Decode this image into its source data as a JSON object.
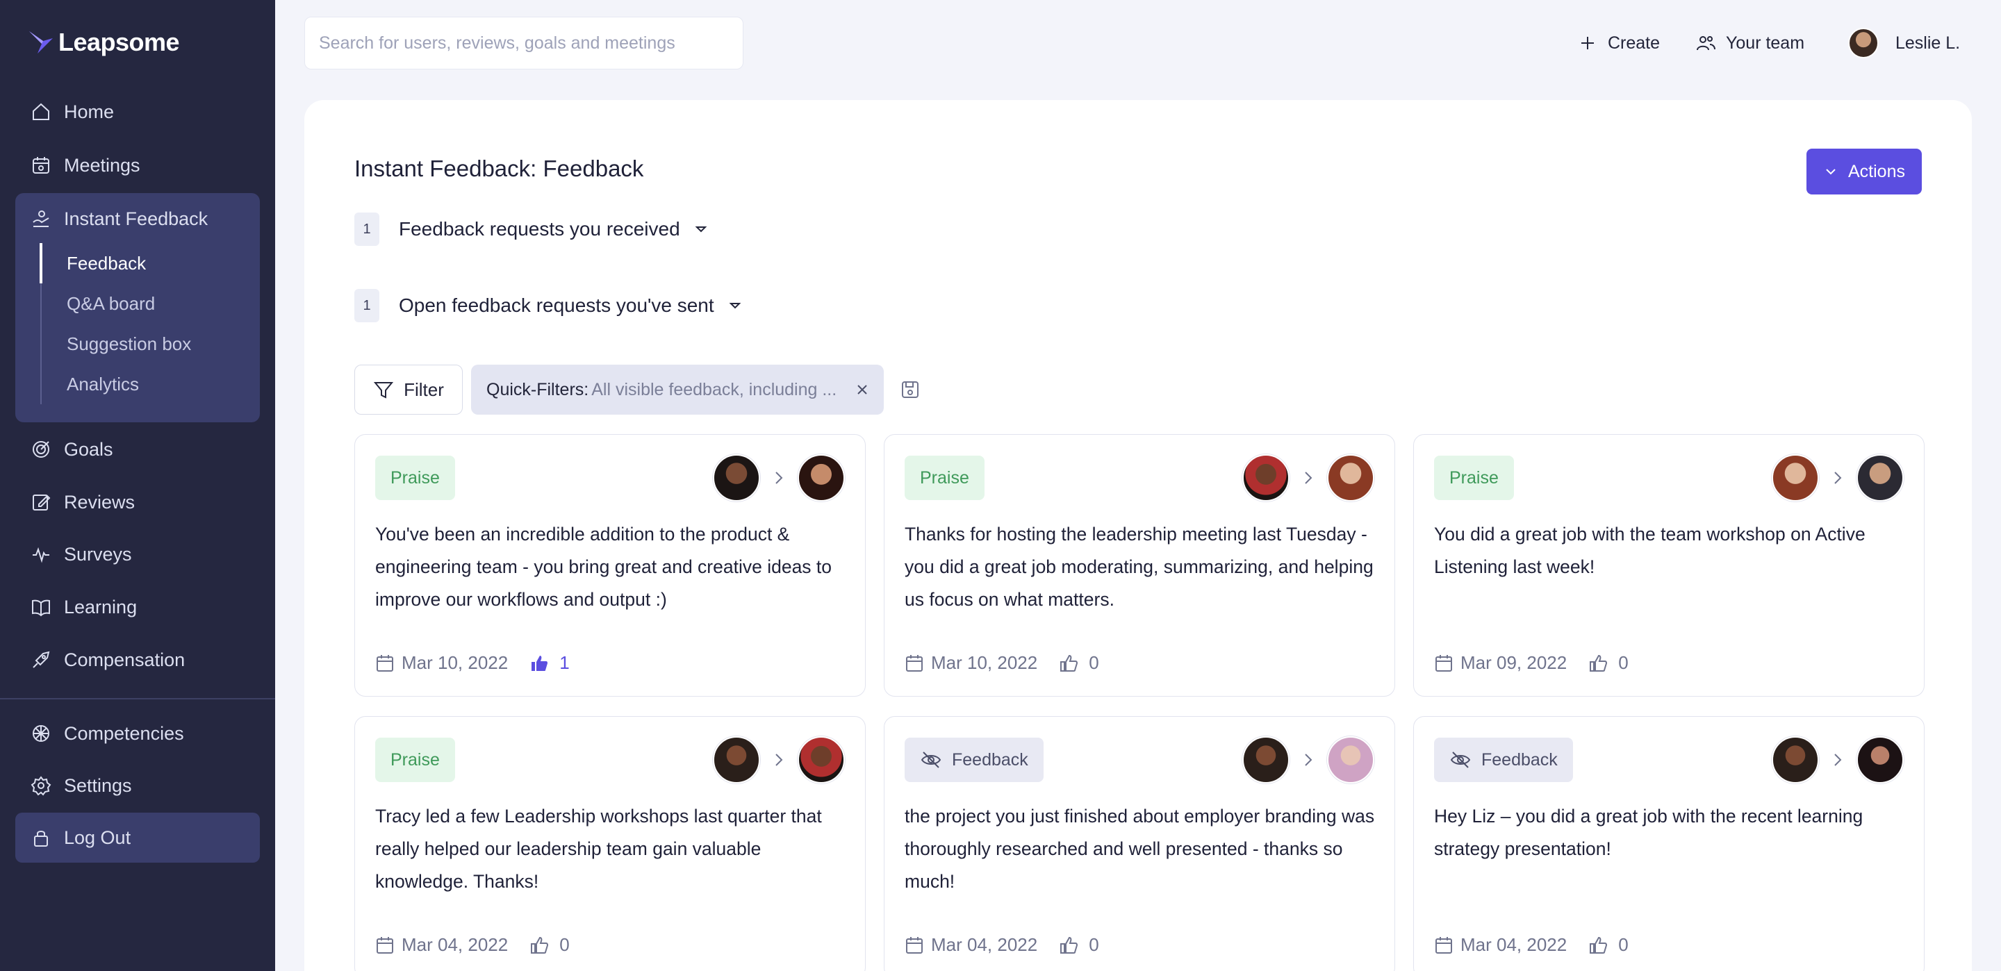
{
  "brand": {
    "name": "Leapsome",
    "accent": "#5b4ee0",
    "sidebar_bg": "#252740"
  },
  "sidebar": {
    "items": [
      {
        "label": "Home",
        "icon": "home-icon"
      },
      {
        "label": "Meetings",
        "icon": "meetings-icon"
      },
      {
        "label": "Instant Feedback",
        "icon": "instant-feedback-icon"
      },
      {
        "label": "Goals",
        "icon": "goals-icon"
      },
      {
        "label": "Reviews",
        "icon": "reviews-icon"
      },
      {
        "label": "Surveys",
        "icon": "surveys-icon"
      },
      {
        "label": "Learning",
        "icon": "learning-icon"
      },
      {
        "label": "Compensation",
        "icon": "compensation-icon"
      },
      {
        "label": "Competencies",
        "icon": "competencies-icon"
      },
      {
        "label": "Settings",
        "icon": "gear-icon"
      }
    ],
    "subitems": [
      {
        "label": "Feedback",
        "active": true
      },
      {
        "label": "Q&A board",
        "active": false
      },
      {
        "label": "Suggestion box",
        "active": false
      },
      {
        "label": "Analytics",
        "active": false
      }
    ],
    "logout_label": "Log Out"
  },
  "topbar": {
    "search_placeholder": "Search for users, reviews, goals and meetings",
    "create_label": "Create",
    "team_label": "Your team",
    "user_name": "Leslie L."
  },
  "page": {
    "title": "Instant Feedback: Feedback",
    "actions_label": "Actions",
    "requests": [
      {
        "count": "1",
        "label": "Feedback requests you received"
      },
      {
        "count": "1",
        "label": "Open feedback requests you've sent"
      }
    ],
    "filter_label": "Filter",
    "quick_filter_label": "Quick-Filters:",
    "quick_filter_value": "All visible feedback, including ..."
  },
  "cards": [
    {
      "type": "Praise",
      "text": "You've been an incredible addition to the product & engineering team - you bring great and creative ideas to improve our workflows and output :)",
      "date": "Mar 10, 2022",
      "likes": "1",
      "liked": true
    },
    {
      "type": "Praise",
      "text": "Thanks for hosting the leadership meeting last Tuesday - you did a great job moderating, summarizing, and helping us focus on what matters.",
      "date": "Mar 10, 2022",
      "likes": "0",
      "liked": false
    },
    {
      "type": "Praise",
      "text": "You did a great job with the team workshop on Active Listening last week!",
      "date": "Mar 09, 2022",
      "likes": "0",
      "liked": false
    },
    {
      "type": "Praise",
      "text": "Tracy led a few Leadership workshops last quarter that really helped our leadership team gain valuable knowledge. Thanks!",
      "date": "Mar 04, 2022",
      "likes": "0",
      "liked": false
    },
    {
      "type": "Feedback",
      "text": "the project you just finished about employer branding was thoroughly researched and well presented - thanks so much!",
      "date": "Mar 04, 2022",
      "likes": "0",
      "liked": false
    },
    {
      "type": "Feedback",
      "text": "Hey Liz – you did a great job with the recent learning strategy presentation!",
      "date": "Mar 04, 2022",
      "likes": "0",
      "liked": false
    }
  ]
}
